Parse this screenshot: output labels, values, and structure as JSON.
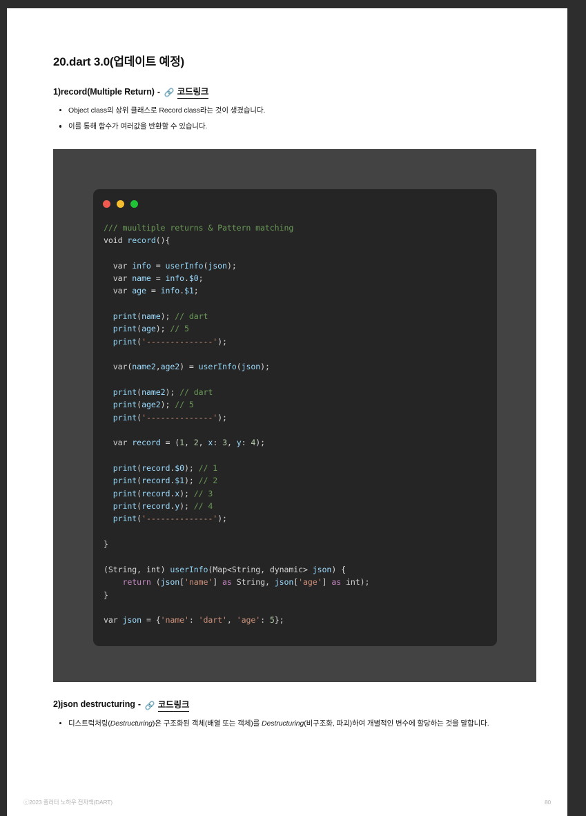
{
  "document": {
    "title": "20.dart 3.0(업데이트 예정)",
    "page_number": "80",
    "footer_copyright": "ⓒ2023 플러터 노하우 전자책(DART)"
  },
  "sections": [
    {
      "heading": "1)record(Multiple Return)",
      "dash": "-",
      "link_icon": "🔗",
      "link_text": "코드링크",
      "bullets": [
        "Object class의 상위 클래스로 Record class라는 것이 생겼습니다.",
        "이를 통해 함수가 여러값을 반환할 수 있습니다."
      ]
    },
    {
      "heading": "2)json destructuring",
      "dash": "-",
      "link_icon": "🔗",
      "link_text": "코드링크",
      "bullets_rich": [
        {
          "part1": "디스트럭처링(",
          "italic1": "Destructuring",
          "part2": ")은 구조화된 객체(배열 또는 객체)를 ",
          "italic2": "Destructuring",
          "part3": "(비구조화, 파괴)하여 개별적인 변수에 할당하는 것을 말합니다."
        }
      ]
    }
  ],
  "code_window": {
    "dots": [
      "red",
      "yellow",
      "green"
    ],
    "language": "dart",
    "lines": [
      "/// muultiple returns & Pattern matching",
      "void record(){",
      "",
      "  var info = userInfo(json);",
      "  var name = info.$0;",
      "  var age = info.$1;",
      "",
      "  print(name); // dart",
      "  print(age); // 5",
      "  print('--------------');",
      "",
      "  var(name2,age2) = userInfo(json);",
      "",
      "  print(name2); // dart",
      "  print(age2); // 5",
      "  print('--------------');",
      "",
      "  var record = (1, 2, x: 3, y: 4);",
      "",
      "  print(record.$0); // 1",
      "  print(record.$1); // 2",
      "  print(record.x); // 3",
      "  print(record.y); // 4",
      "  print('--------------');",
      "",
      "}",
      "",
      "(String, int) userInfo(Map<String, dynamic> json) {",
      "    return (json['name'] as String, json['age'] as int);",
      "}",
      "",
      "var json = {'name': 'dart', 'age': 5};"
    ]
  },
  "colors": {
    "page_frame": "#2d2d2d",
    "code_backdrop": "#434343",
    "code_window_bg": "#252526",
    "dot_red": "#f05a4f",
    "dot_yellow": "#f6bd31",
    "dot_green": "#21c436",
    "comment": "#6a9955",
    "keyword": "#c586c0",
    "identifier": "#9cdcfe",
    "string": "#ce9178",
    "number": "#b5cea8",
    "plain": "#d4d4d4"
  }
}
